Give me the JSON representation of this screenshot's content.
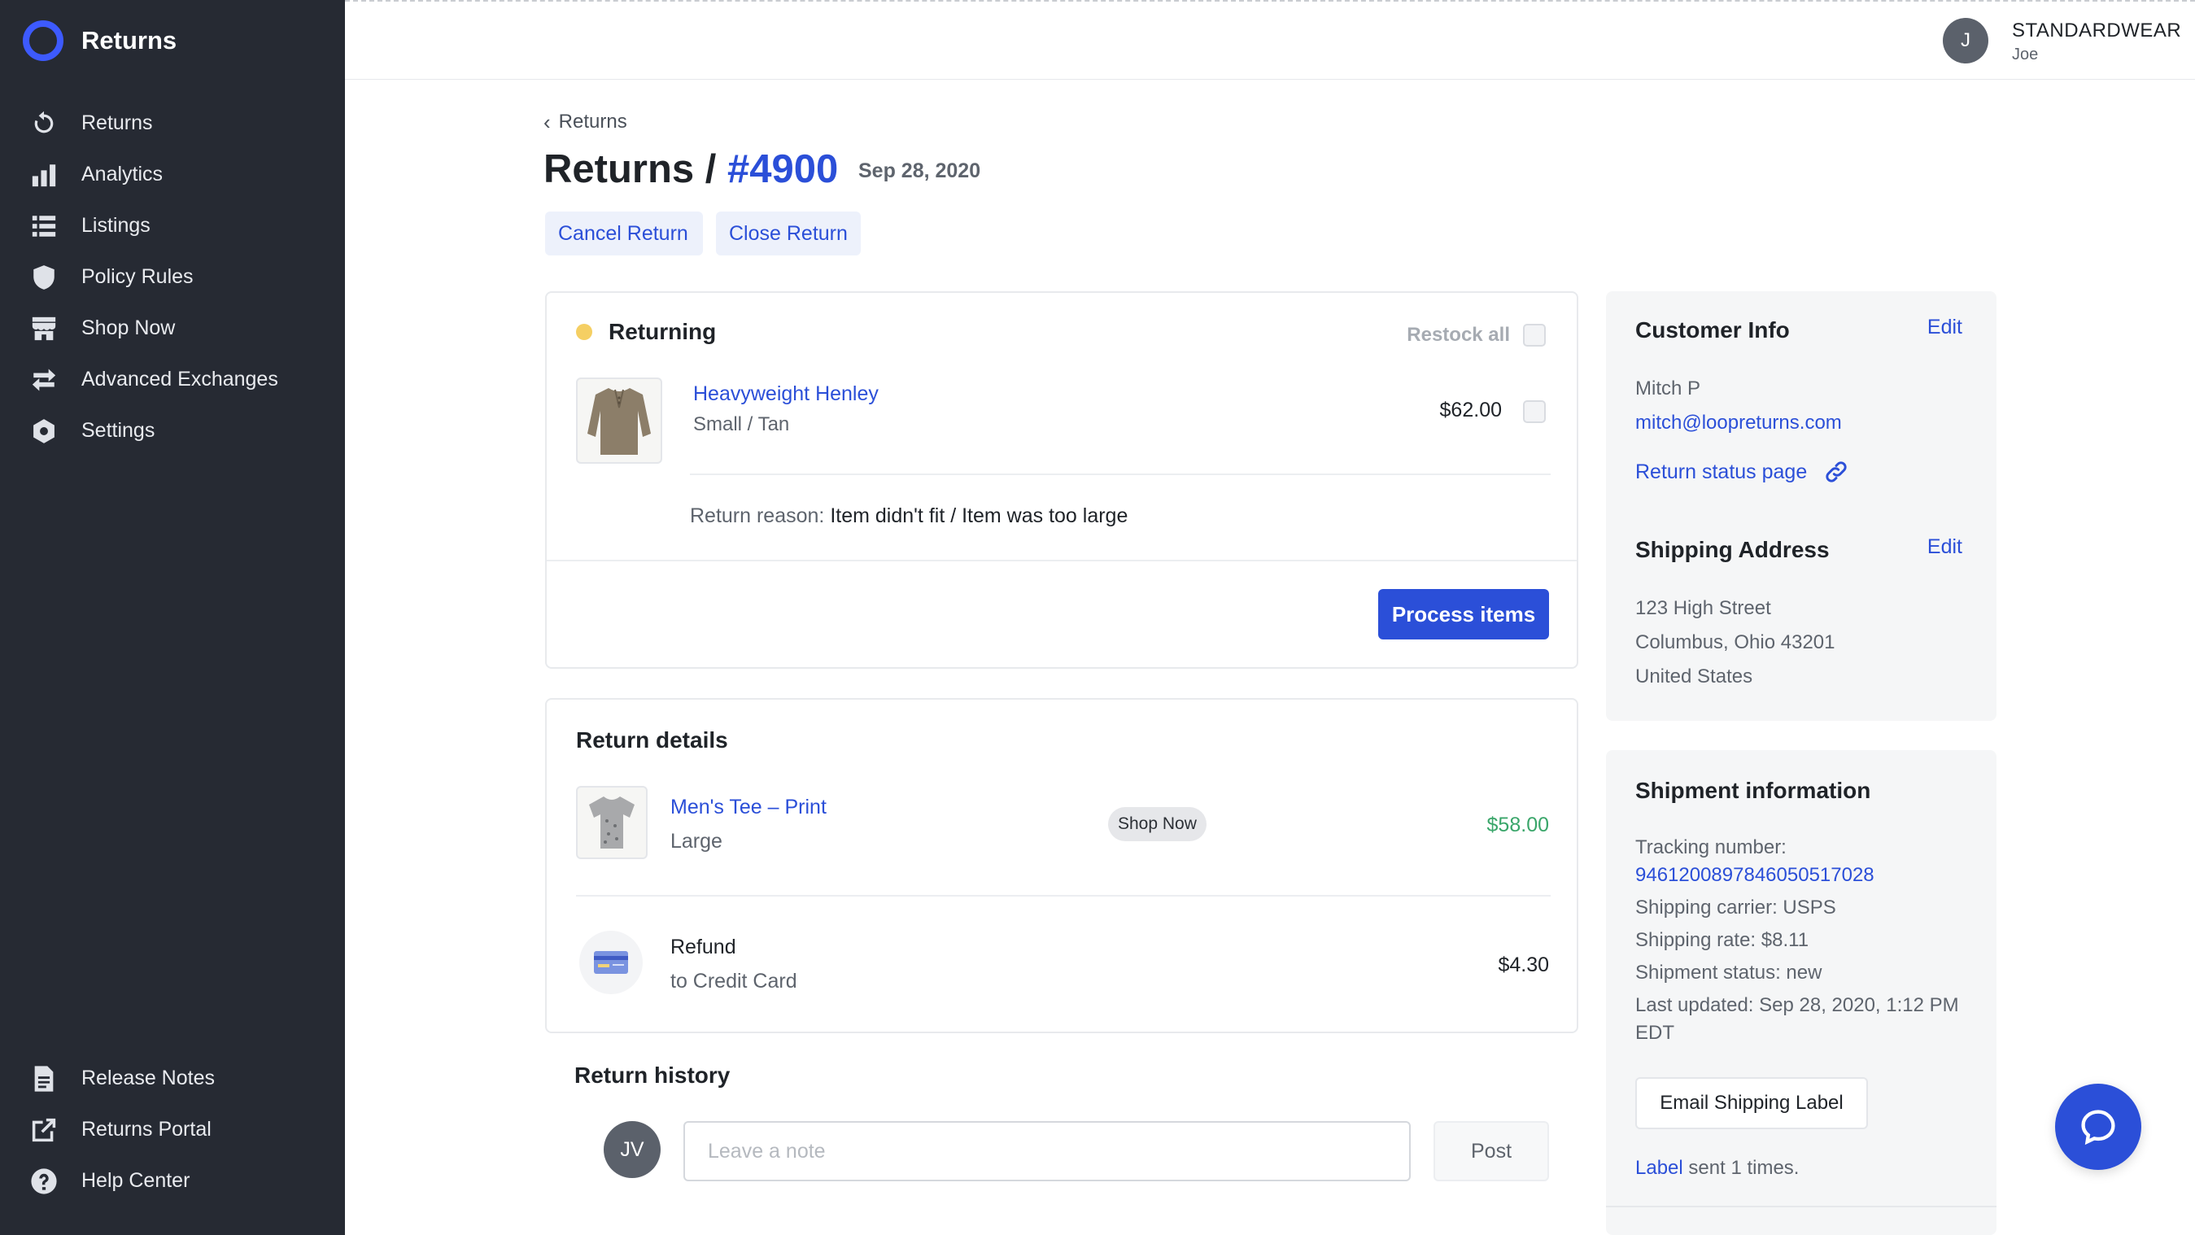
{
  "app": {
    "title": "Returns"
  },
  "sidebar": {
    "items": [
      {
        "label": "Returns",
        "icon": "refresh-icon"
      },
      {
        "label": "Analytics",
        "icon": "bar-chart-icon"
      },
      {
        "label": "Listings",
        "icon": "list-icon"
      },
      {
        "label": "Policy Rules",
        "icon": "shield-icon"
      },
      {
        "label": "Shop Now",
        "icon": "storefront-icon"
      },
      {
        "label": "Advanced Exchanges",
        "icon": "swap-icon"
      },
      {
        "label": "Settings",
        "icon": "gear-icon"
      }
    ],
    "bottom_items": [
      {
        "label": "Release Notes",
        "icon": "document-icon"
      },
      {
        "label": "Returns Portal",
        "icon": "external-link-icon"
      },
      {
        "label": "Help Center",
        "icon": "help-icon"
      }
    ]
  },
  "topbar": {
    "avatar_initial": "J",
    "store_name": "STANDARDWEAR",
    "user_name": "Joe"
  },
  "header": {
    "back_label": "Returns",
    "title_prefix": "Returns /",
    "order_number": "#4900",
    "date": "Sep 28, 2020",
    "cancel_label": "Cancel Return",
    "close_label": "Close Return"
  },
  "returning": {
    "title": "Returning",
    "status_color": "#f5cf63",
    "restock_label": "Restock all",
    "item": {
      "name": "Heavyweight Henley",
      "variant": "Small / Tan",
      "price": "$62.00"
    },
    "reason_label": "Return reason:",
    "reason_value": "Item didn't fit / Item was too large",
    "process_label": "Process items"
  },
  "return_details": {
    "title": "Return details",
    "item": {
      "name": "Men's Tee – Print",
      "variant": "Large",
      "badge": "Shop Now",
      "price": "$58.00"
    },
    "refund": {
      "title": "Refund",
      "subtitle": "to Credit Card",
      "amount": "$4.30"
    }
  },
  "history": {
    "title": "Return history",
    "avatar_initials": "JV",
    "note_placeholder": "Leave a note",
    "post_label": "Post"
  },
  "customer": {
    "title": "Customer Info",
    "edit_label": "Edit",
    "name": "Mitch P",
    "email": "mitch@loopreturns.com",
    "status_link": "Return status page"
  },
  "shipping_address": {
    "title": "Shipping Address",
    "edit_label": "Edit",
    "line1": "123 High Street",
    "line2": "Columbus, Ohio 43201",
    "line3": "United States"
  },
  "shipment": {
    "title": "Shipment information",
    "tracking_label": "Tracking number:",
    "tracking_number": "9461200897846050517028",
    "carrier": "Shipping carrier: USPS",
    "rate": "Shipping rate: $8.11",
    "status": "Shipment status: new",
    "updated_line1": "Last updated: Sep 28, 2020, 1:12 PM",
    "updated_line2": "EDT",
    "email_label_btn": "Email Shipping Label",
    "label_link": "Label",
    "label_sent": "sent 1 times."
  },
  "colors": {
    "accent": "#2b4fd8",
    "sidebar": "#262a33",
    "success": "#3aa66a"
  }
}
